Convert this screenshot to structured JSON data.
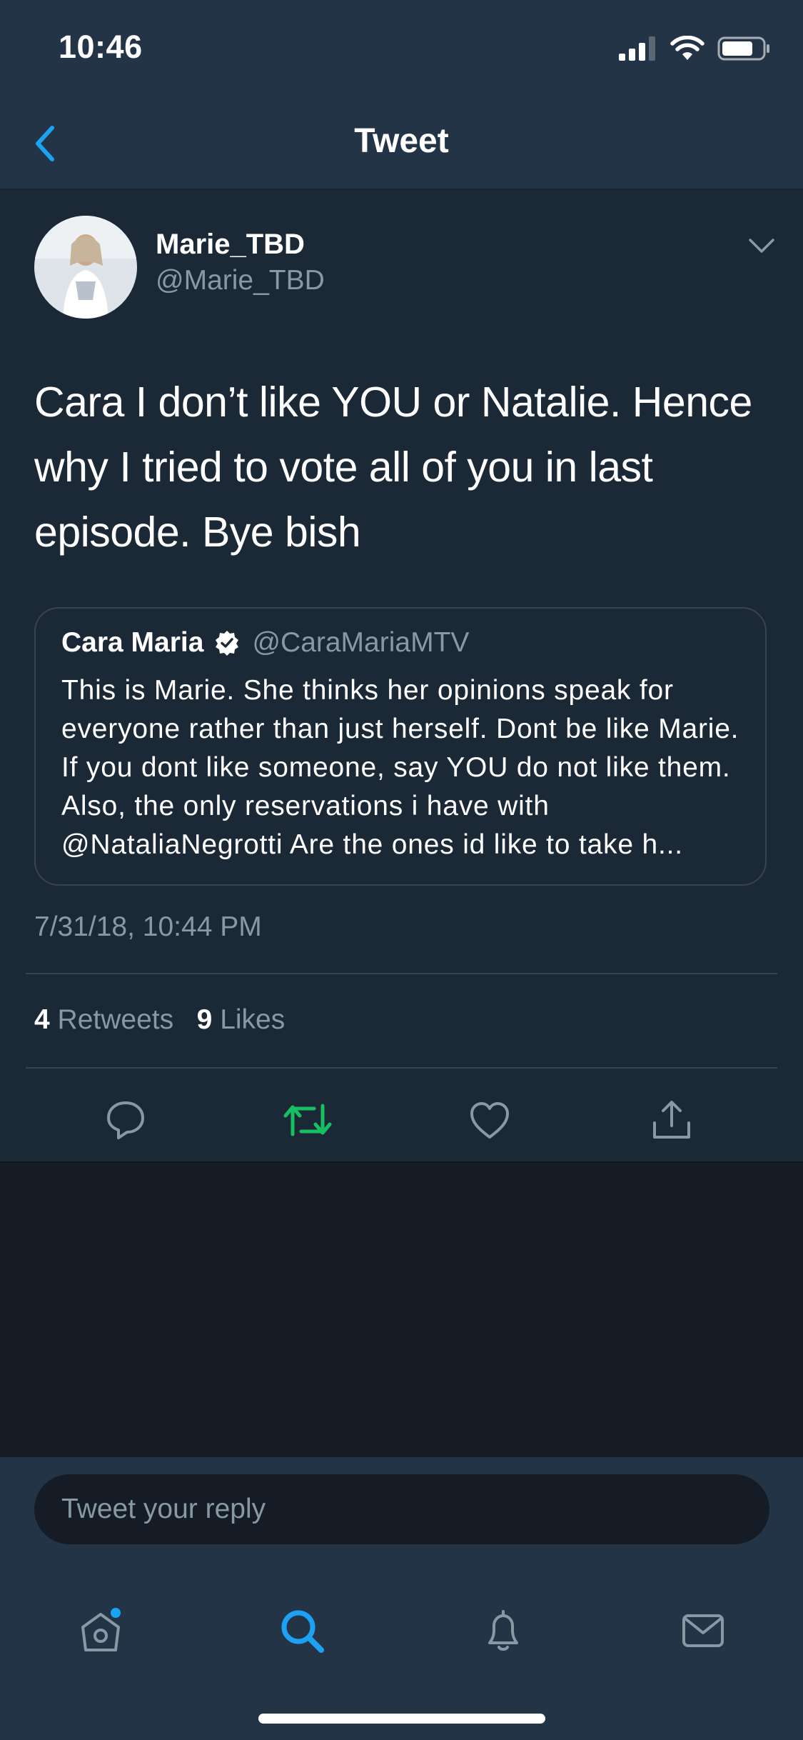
{
  "status_bar": {
    "time": "10:46",
    "icons": [
      "cellular-signal-icon",
      "wifi-icon",
      "battery-icon"
    ]
  },
  "nav": {
    "title": "Tweet",
    "back_icon": "chevron-left-icon"
  },
  "tweet": {
    "author": {
      "name": "Marie_TBD",
      "handle": "@Marie_TBD"
    },
    "text": "Cara I don’t like YOU or Natalie. Hence why I tried to vote all of you in last episode. Bye bish",
    "quoted": {
      "name": "Cara Maria",
      "verified": true,
      "handle": "@CaraMariaMTV",
      "text": "This is Marie. She thinks her opinions speak for everyone rather than just herself. Dont be like Marie. If you dont like someone, say YOU do not like them. Also, the only reservations i have with @NataliaNegrotti Are the ones id like to take h..."
    },
    "timestamp": "7/31/18, 10:44 PM",
    "stats": {
      "retweets_count": "4",
      "retweets_label": "Retweets",
      "likes_count": "9",
      "likes_label": "Likes"
    },
    "actions": [
      "reply-icon",
      "retweet-icon",
      "like-icon",
      "share-icon"
    ]
  },
  "reply": {
    "placeholder": "Tweet your reply"
  },
  "tabbar": {
    "items": [
      "home-icon",
      "search-icon",
      "notifications-icon",
      "messages-icon"
    ],
    "active": "search-icon"
  },
  "colors": {
    "accent": "#1da1f2",
    "retweet_green": "#17bf63",
    "secondary_text": "#8899a6",
    "bar_background": "#243447",
    "tweet_background": "#1b2836",
    "page_background": "#151c25"
  }
}
